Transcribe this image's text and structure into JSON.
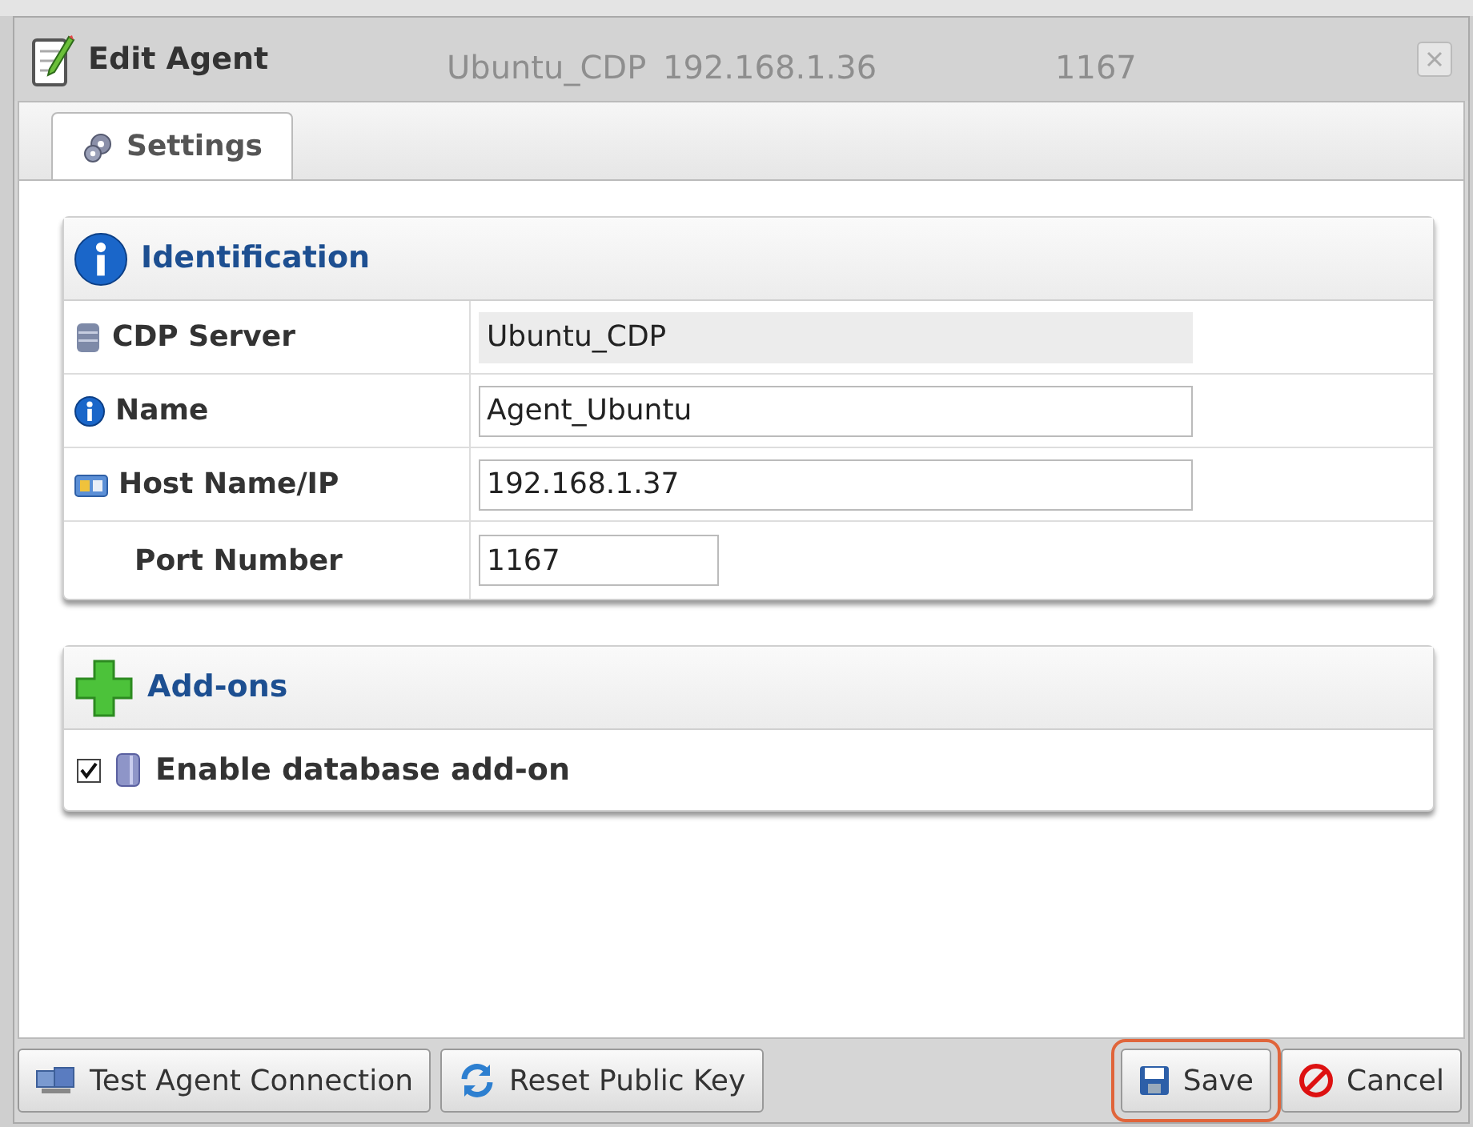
{
  "background_row": [
    "Ubuntu_CDP",
    "192.168.1.36",
    "1167"
  ],
  "window": {
    "title": "Edit Agent"
  },
  "tabs": [
    {
      "label": "Settings",
      "selected": true
    }
  ],
  "identification": {
    "title": "Identification",
    "fields": [
      {
        "label": "CDP Server",
        "value": "Ubuntu_CDP",
        "readonly": true,
        "kind": "text"
      },
      {
        "label": "Name",
        "value": "Agent_Ubuntu",
        "readonly": false,
        "kind": "text"
      },
      {
        "label": "Host Name/IP",
        "value": "192.168.1.37",
        "readonly": false,
        "kind": "text"
      },
      {
        "label": "Port Number",
        "value": "1167",
        "readonly": false,
        "kind": "number"
      }
    ]
  },
  "addons": {
    "title": "Add-ons",
    "options": [
      {
        "label": "Enable database add-on",
        "checked": true
      }
    ]
  },
  "buttons": [
    {
      "label": "Test Agent Connection",
      "highlighted": false
    },
    {
      "label": "Reset Public Key",
      "highlighted": false
    },
    {
      "label": "Save",
      "highlighted": true
    },
    {
      "label": "Cancel",
      "highlighted": false
    }
  ]
}
